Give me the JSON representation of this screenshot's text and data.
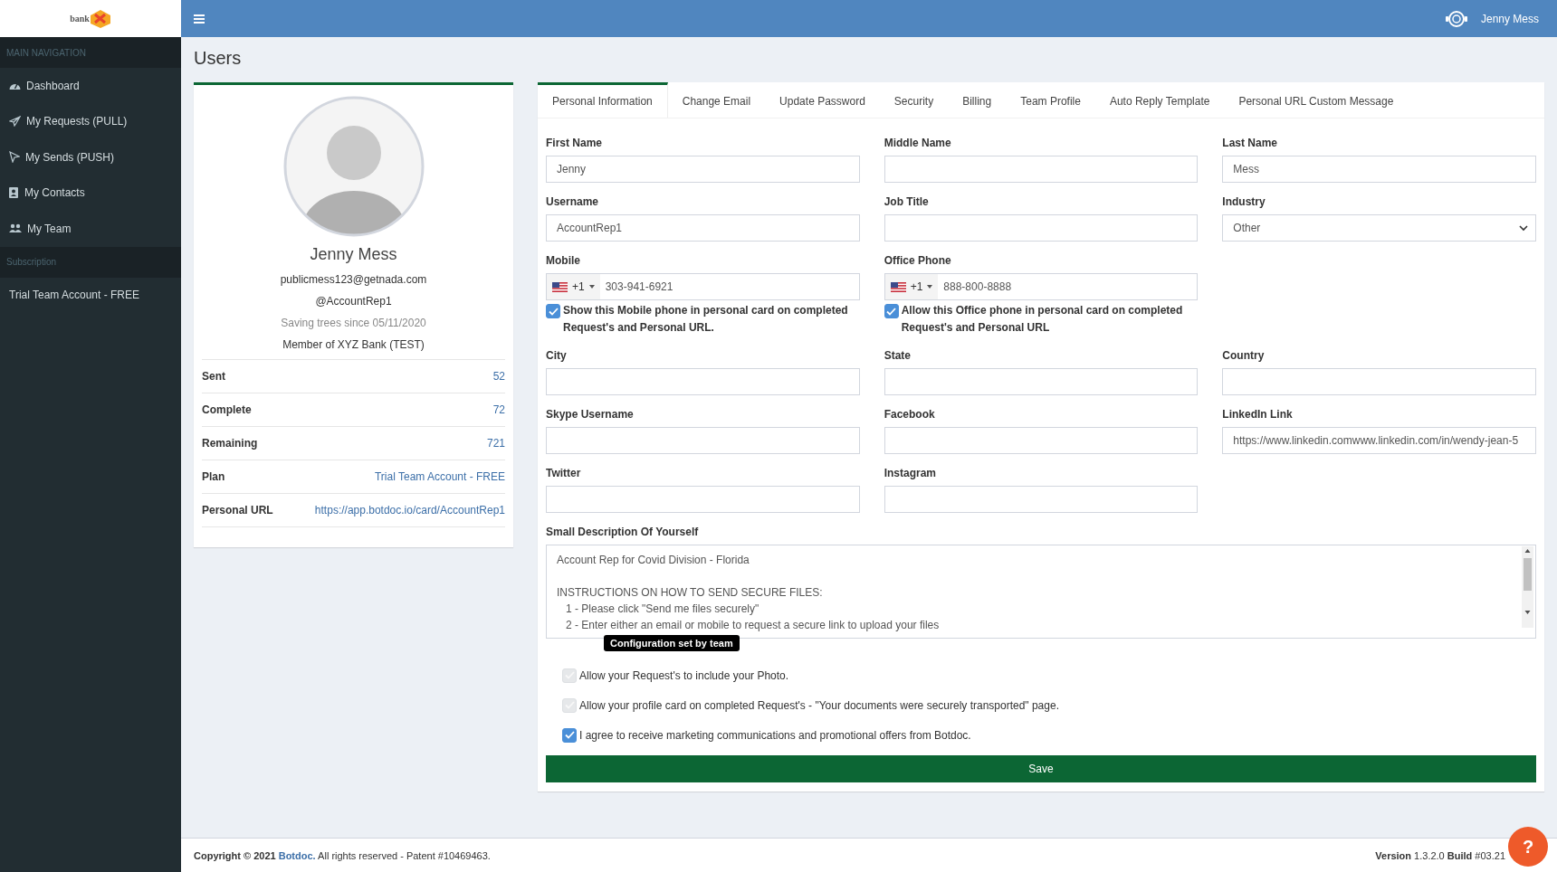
{
  "logo": {
    "text": "bank"
  },
  "topbar": {
    "user_name": "Jenny Mess"
  },
  "sidebar": {
    "sections": [
      {
        "header": "MAIN NAVIGATION",
        "items": [
          {
            "label": "Dashboard"
          },
          {
            "label": "My Requests (PULL)"
          },
          {
            "label": "My Sends (PUSH)"
          },
          {
            "label": "My Contacts"
          },
          {
            "label": "My Team"
          }
        ]
      },
      {
        "header": "Subscription",
        "items": [
          {
            "label": "Trial Team Account - FREE"
          }
        ]
      }
    ]
  },
  "page_title": "Users",
  "profile": {
    "name": "Jenny Mess",
    "email": "publicmess123@getnada.com",
    "username": "@AccountRep1",
    "since": "Saving trees since 05/11/2020",
    "member": "Member of XYZ Bank (TEST)",
    "stats": [
      {
        "label": "Sent",
        "value": "52"
      },
      {
        "label": "Complete",
        "value": "72"
      },
      {
        "label": "Remaining",
        "value": "721"
      },
      {
        "label": "Plan",
        "value": "Trial Team Account - FREE"
      },
      {
        "label": "Personal URL",
        "value": "https://app.botdoc.io/card/AccountRep1"
      }
    ]
  },
  "tabs": [
    {
      "label": "Personal Information",
      "selected": true
    },
    {
      "label": "Change Email",
      "selected": false
    },
    {
      "label": "Update Password",
      "selected": false
    },
    {
      "label": "Security",
      "selected": false
    },
    {
      "label": "Billing",
      "selected": false
    },
    {
      "label": "Team Profile",
      "selected": false
    },
    {
      "label": "Auto Reply Template",
      "selected": false
    },
    {
      "label": "Personal URL Custom Message",
      "selected": false
    }
  ],
  "form": {
    "rows": [
      [
        {
          "kind": "text",
          "label": "First Name",
          "value": "Jenny"
        },
        {
          "kind": "text",
          "label": "Middle Name"
        },
        {
          "kind": "text",
          "label": "Last Name",
          "value": "Mess"
        }
      ],
      [
        {
          "kind": "text",
          "label": "Username",
          "value": "AccountRep1"
        },
        {
          "kind": "text",
          "label": "Job Title"
        },
        {
          "kind": "select",
          "label": "Industry",
          "value": "Other"
        }
      ],
      [
        {
          "kind": "phone",
          "label": "Mobile",
          "code": "+1",
          "value": "303-941-6921",
          "checkbox": {
            "label": "Show this Mobile phone in personal card on completed Request's and Personal URL.",
            "checked": true
          }
        },
        {
          "kind": "phone",
          "label": "Office Phone",
          "code": "+1",
          "value": "888-800-8888",
          "checkbox": {
            "label": "Allow this Office phone in personal card on completed Request's and Personal URL",
            "checked": true
          }
        }
      ],
      [
        {
          "kind": "text",
          "label": "City"
        },
        {
          "kind": "text",
          "label": "State"
        },
        {
          "kind": "text",
          "label": "Country"
        }
      ],
      [
        {
          "kind": "text",
          "label": "Skype Username"
        },
        {
          "kind": "text",
          "label": "Facebook"
        },
        {
          "kind": "text",
          "label": "LinkedIn Link",
          "value": "https://www.linkedin.comwww.linkedin.com/in/wendy-jean-5"
        }
      ],
      [
        {
          "kind": "text",
          "label": "Twitter"
        },
        {
          "kind": "text",
          "label": "Instagram"
        }
      ]
    ],
    "description": {
      "label": "Small Description Of Yourself",
      "value": "Account Rep for Covid Division - Florida\n\nINSTRUCTIONS ON HOW TO SEND SECURE FILES:\n   1 - Please click \"Send me files securely\"\n   2 - Enter either an email or mobile to request a secure link to upload your files"
    },
    "tooltip": "Configuration set by team",
    "options": [
      {
        "label": "Allow your Request's to include your Photo.",
        "checked": true,
        "disabled": true
      },
      {
        "label": "Allow your profile card on completed Request's - \"Your documents were securely transported\" page.",
        "checked": true,
        "disabled": true
      },
      {
        "label": "I agree to receive marketing communications and promotional offers from Botdoc.",
        "checked": true,
        "disabled": false
      }
    ],
    "save": "Save"
  },
  "footer": {
    "copyright": "Copyright © 2021",
    "link": "Botdoc.",
    "rest": "All rights reserved - Patent #10469463.",
    "version": "**Version** 1.3.2.0 **Build** #03.21"
  },
  "help_button": "?"
}
